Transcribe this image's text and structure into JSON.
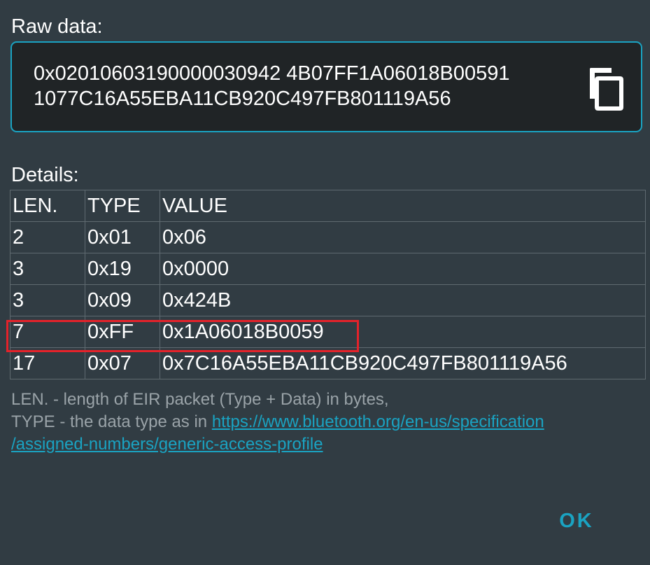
{
  "raw": {
    "label": "Raw data:",
    "value": "0x0201060319000003094 24B07FF1A06018B005911077C16A55EBA11CB920C497FB801119A56",
    "line1": "0x02010603190000030942 4B07FF1A06018B00591",
    "line2": "1077C16A55EBA11CB920C497FB801119A56",
    "copy_icon": "copy-icon"
  },
  "details": {
    "label": "Details:",
    "headers": [
      "LEN.",
      "TYPE",
      "VALUE"
    ],
    "rows": [
      {
        "len": "2",
        "type": "0x01",
        "value": "0x06"
      },
      {
        "len": "3",
        "type": "0x19",
        "value": "0x0000"
      },
      {
        "len": "3",
        "type": "0x09",
        "value": "0x424B"
      },
      {
        "len": "7",
        "type": "0xFF",
        "value": "0x1A06018B0059"
      },
      {
        "len": "17",
        "type": "0x07",
        "value": "0x7C16A55EBA11CB920C497FB801119A56"
      }
    ],
    "highlight_color": "#e4222a"
  },
  "footnote": {
    "line1": "LEN. - length of EIR packet (Type + Data) in bytes,",
    "line2_prefix": "TYPE - the data type as in ",
    "link_part1": "https://www.bluetooth.org/en-us/specification",
    "link_part2": "/assigned-numbers/generic-access-profile"
  },
  "ok_label": "OK",
  "colors": {
    "background": "#313c43",
    "accent": "#1aa3c2",
    "raw_box_bg": "#202426"
  }
}
